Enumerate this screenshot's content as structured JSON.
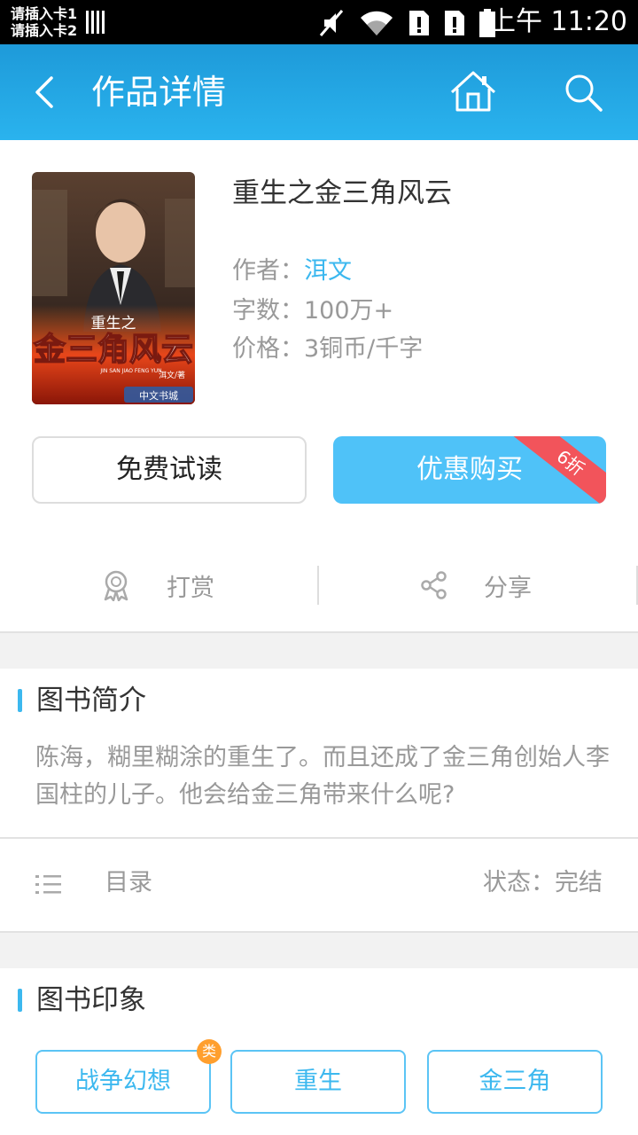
{
  "status_bar": {
    "sim1": "请插入卡1",
    "sim2": "请插入卡2",
    "time": "上午 11:20",
    "icons": [
      "sim-bars-icon",
      "mute-icon",
      "wifi-icon",
      "sim-alert-icon",
      "sim-alert-icon",
      "battery-icon"
    ]
  },
  "app_bar": {
    "title": "作品详情",
    "back_icon": "back-arrow-icon",
    "home_icon": "home-icon",
    "search_icon": "search-icon",
    "color": "#29a9e6"
  },
  "book": {
    "title": "重生之金三角风云",
    "cover_text": {
      "small_title": "重生之",
      "main_title": "金三角风云",
      "pinyin": "JIN SAN JIAO FENG YUN",
      "author_mark": "洱文/著",
      "publisher": "中文书城"
    },
    "author_label": "作者：",
    "author": "洱文",
    "words_label": "字数：",
    "words": "100万+",
    "price_label": "价格：",
    "price": "3铜币/千字"
  },
  "buttons": {
    "trial": "免费试读",
    "buy": "优惠购买",
    "discount": "6折",
    "buy_color": "#4fc2f8",
    "discount_color": "#f2545b"
  },
  "actions": {
    "reward": "打赏",
    "reward_icon": "award-icon",
    "share": "分享",
    "share_icon": "share-icon"
  },
  "intro": {
    "title": "图书简介",
    "text": "陈海，糊里糊涂的重生了。而且还成了金三角创始人李国柱的儿子。他会给金三角带来什么呢?"
  },
  "toc": {
    "label": "目录",
    "icon": "list-icon",
    "status": "状态：完结"
  },
  "impression": {
    "title": "图书印象",
    "badge": "类",
    "tags": [
      "战争幻想",
      "重生",
      "金三角"
    ]
  }
}
